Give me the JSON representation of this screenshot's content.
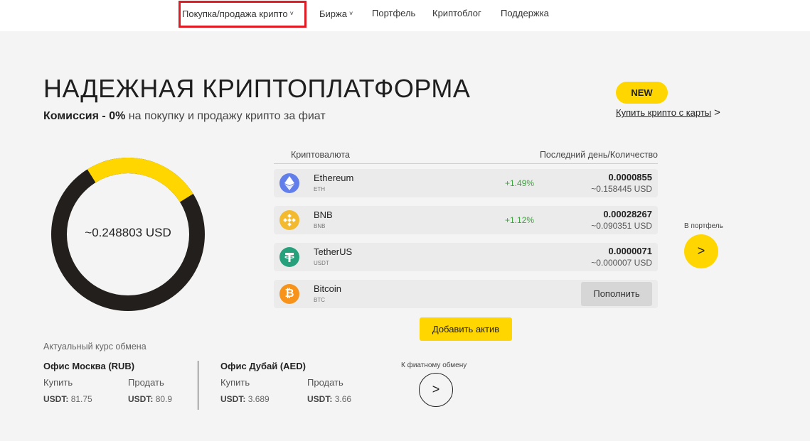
{
  "nav": {
    "items": [
      {
        "label": "Покупка/продажа крипто",
        "dropdown": true
      },
      {
        "label": "Биржа",
        "dropdown": true
      },
      {
        "label": "Портфель",
        "dropdown": false
      },
      {
        "label": "Криптоблог",
        "dropdown": false
      },
      {
        "label": "Поддержка",
        "dropdown": false
      }
    ],
    "chevron": "˅"
  },
  "hero": {
    "title": "НАДЕЖНАЯ КРИПТОПЛАТФОРМА",
    "subtitle_bold": "Комиссия - 0%",
    "subtitle_rest": " на покупку и продажу крипто за фиат"
  },
  "promo": {
    "badge": "NEW",
    "link": "Купить крипто с карты",
    "arrow": ">"
  },
  "balance": {
    "total": "~0.248803 USD",
    "yellow_fraction": 0.25,
    "colors": {
      "yellow": "#ffd600",
      "dark": "#231f1c"
    }
  },
  "assets": {
    "col_currency": "Криптовалюта",
    "col_last_day": "Последний день/Количество",
    "rows": [
      {
        "name": "Ethereum",
        "ticker": "ETH",
        "change": "+1.49%",
        "amount": "0.0000855",
        "usd": "~0.158445 USD",
        "icon": "ethereum-icon",
        "color": "#627eea"
      },
      {
        "name": "BNB",
        "ticker": "BNB",
        "change": "+1.12%",
        "amount": "0.00028267",
        "usd": "~0.090351 USD",
        "icon": "bnb-icon",
        "color": "#f3ba2f"
      },
      {
        "name": "TetherUS",
        "ticker": "USDT",
        "change": "",
        "amount": "0.0000071",
        "usd": "~0.000007 USD",
        "icon": "tether-icon",
        "color": "#26a17b"
      },
      {
        "name": "Bitcoin",
        "ticker": "BTC",
        "change": "",
        "action": "Пополнить",
        "icon": "bitcoin-icon",
        "color": "#f7931a"
      }
    ],
    "add_button": "Добавить актив"
  },
  "portfolio": {
    "label": "В портфель",
    "arrow": ">"
  },
  "rates": {
    "title": "Актуальный курс обмена",
    "buy": "Купить",
    "sell": "Продать",
    "currency": "USDT:",
    "offices": [
      {
        "name": "Офис Москва (RUB)",
        "buy": "81.75",
        "sell": "80.9"
      },
      {
        "name": "Офис Дубай (AED)",
        "buy": "3.689",
        "sell": "3.66"
      }
    ]
  },
  "fiat": {
    "label": "К фиатному обмену",
    "arrow": ">"
  }
}
